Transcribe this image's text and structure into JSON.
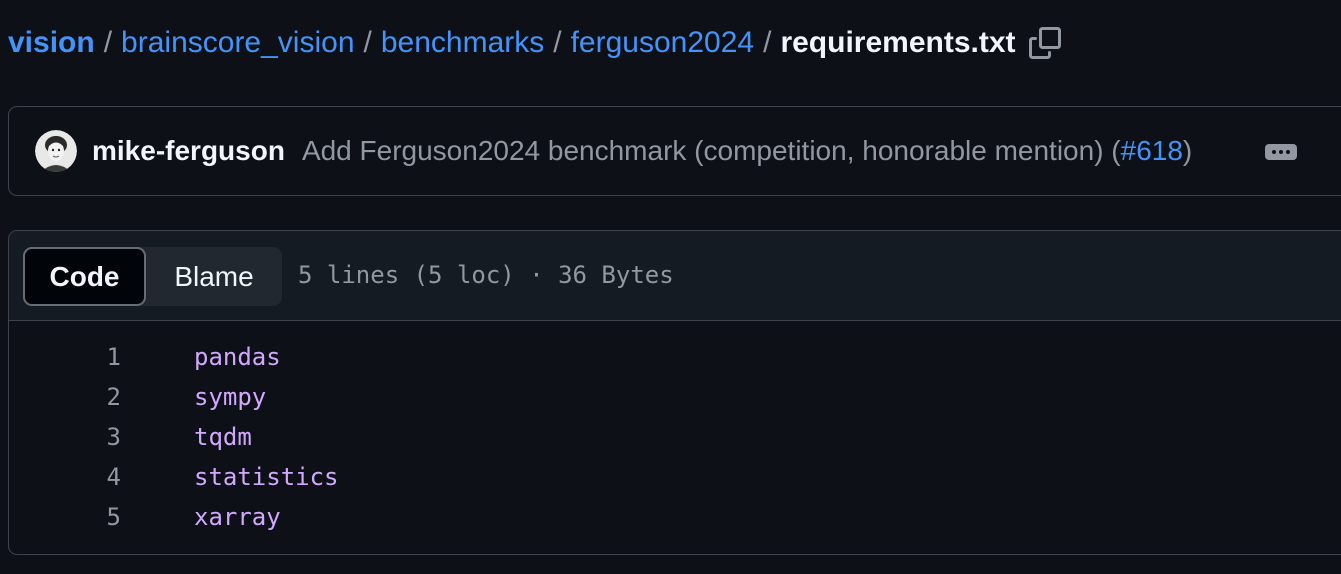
{
  "breadcrumb": {
    "items": [
      "vision",
      "brainscore_vision",
      "benchmarks",
      "ferguson2024"
    ],
    "separator": "/",
    "current": "requirements.txt"
  },
  "commit": {
    "author": "mike-ferguson",
    "message_prefix": "Add Ferguson2024 benchmark (competition, honorable mention) (",
    "pr": "#618",
    "message_suffix": ")"
  },
  "file": {
    "tabs": [
      "Code",
      "Blame"
    ],
    "active_tab": "Code",
    "meta": "5 lines (5 loc) · 36 Bytes",
    "lines": [
      {
        "num": "1",
        "text": "pandas"
      },
      {
        "num": "2",
        "text": "sympy"
      },
      {
        "num": "3",
        "text": "tqdm"
      },
      {
        "num": "4",
        "text": "statistics"
      },
      {
        "num": "5",
        "text": "xarray"
      }
    ]
  },
  "colors": {
    "background": "#0d1117",
    "link": "#4493f8",
    "code_text": "#d2a8ff",
    "muted": "#9198a1",
    "border": "#3d444d"
  },
  "icons": {
    "copy": "copy-icon",
    "more": "kebab-horizontal-icon"
  }
}
